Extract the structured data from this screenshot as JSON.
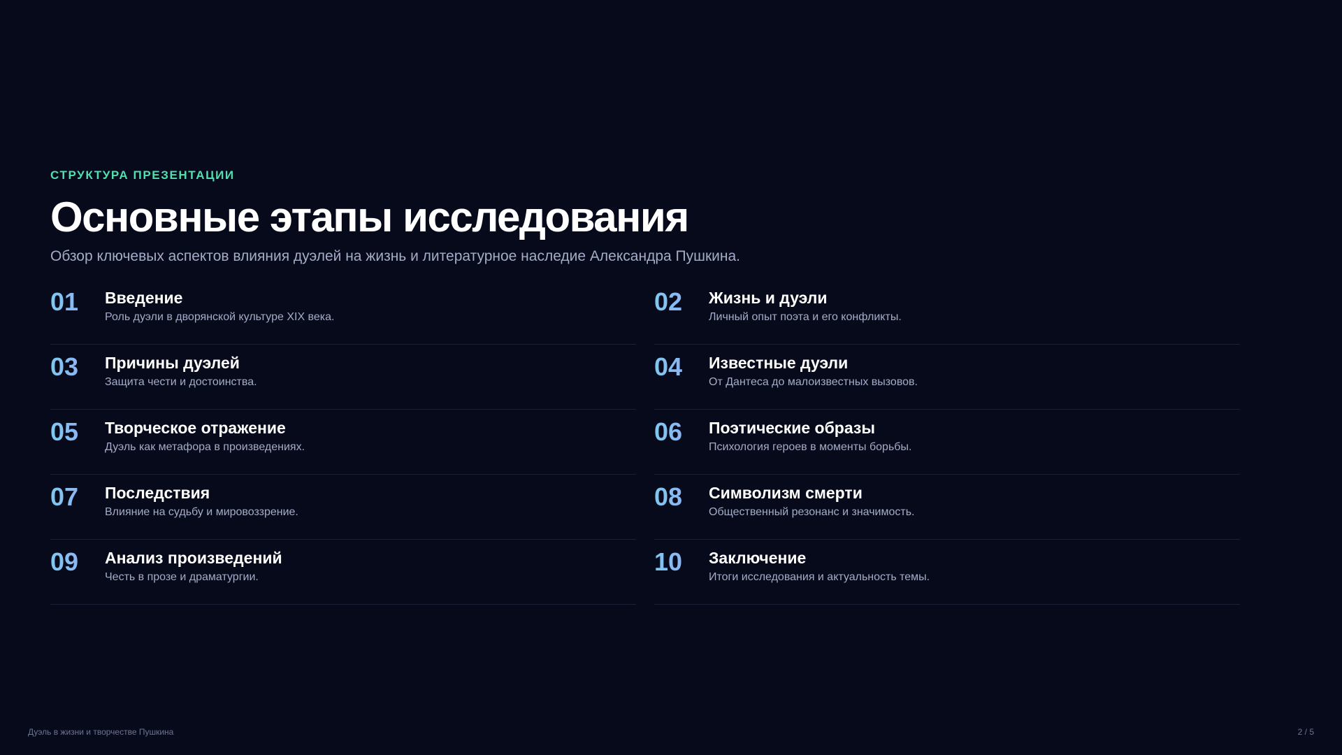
{
  "slide": {
    "eyebrow": "СТРУКТУРА ПРЕЗЕНТАЦИИ",
    "title": "Основные этапы исследования",
    "subtitle": "Обзор ключевых аспектов влияния дуэлей на жизнь и литературное наследие Александра Пушкина."
  },
  "items": [
    {
      "num": "01",
      "title": "Введение",
      "desc": "Роль дуэли в дворянской культуре XIX века."
    },
    {
      "num": "02",
      "title": "Жизнь и дуэли",
      "desc": "Личный опыт поэта и его конфликты."
    },
    {
      "num": "03",
      "title": "Причины дуэлей",
      "desc": "Защита чести и достоинства."
    },
    {
      "num": "04",
      "title": "Известные дуэли",
      "desc": "От Дантеса до малоизвестных вызовов."
    },
    {
      "num": "05",
      "title": "Творческое отражение",
      "desc": "Дуэль как метафора в произведениях."
    },
    {
      "num": "06",
      "title": "Поэтические образы",
      "desc": "Психология героев в моменты борьбы."
    },
    {
      "num": "07",
      "title": "Последствия",
      "desc": "Влияние на судьбу и мировоззрение."
    },
    {
      "num": "08",
      "title": "Символизм смерти",
      "desc": "Общественный резонанс и значимость."
    },
    {
      "num": "09",
      "title": "Анализ произведений",
      "desc": "Честь в прозе и драматургии."
    },
    {
      "num": "10",
      "title": "Заключение",
      "desc": "Итоги исследования и актуальность темы."
    }
  ],
  "footer": {
    "left": "Дуэль в жизни и творчестве Пушкина",
    "right": "2 / 5"
  },
  "colors": {
    "background": "#070a1a",
    "accent": "#4ee0b0",
    "number_gradient_start": "#7ec8f0",
    "number_gradient_end": "#9aa4f6"
  }
}
